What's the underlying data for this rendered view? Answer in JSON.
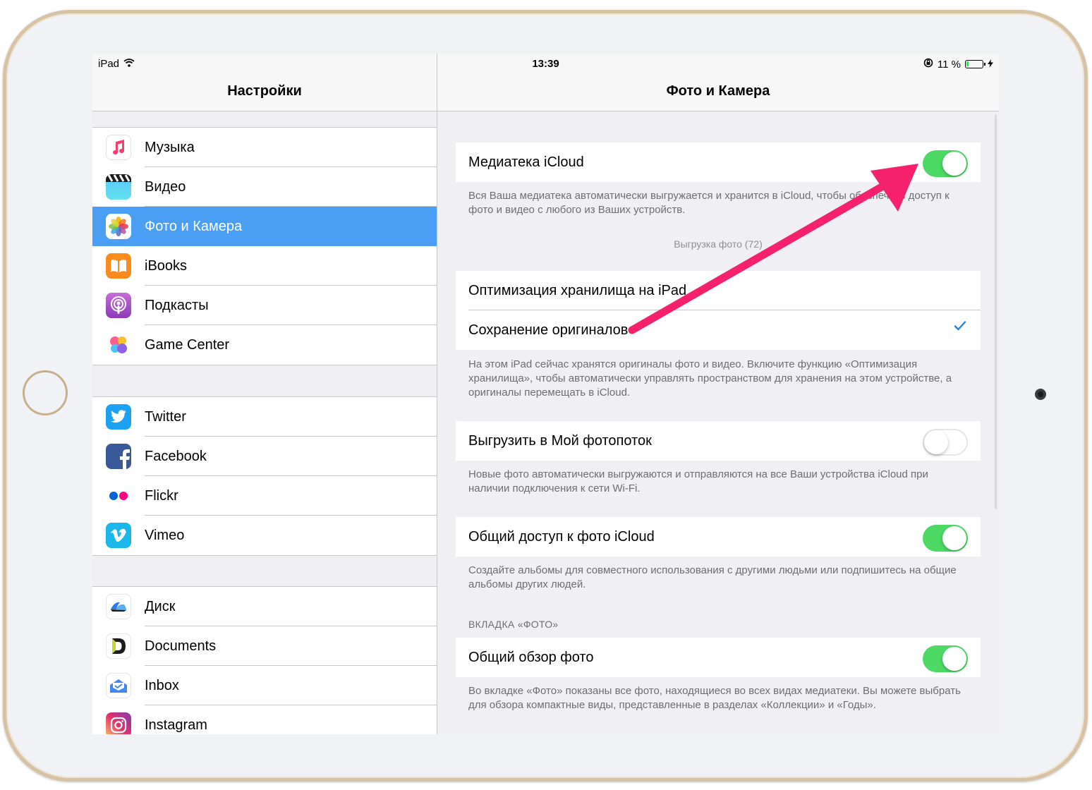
{
  "status_bar": {
    "device": "iPad",
    "time": "13:39",
    "battery_percent": "11 %",
    "battery_level": 0.11
  },
  "master": {
    "title": "Настройки",
    "groups": [
      {
        "items": [
          {
            "label": "Музыка",
            "icon": "music-icon"
          },
          {
            "label": "Видео",
            "icon": "video-icon"
          },
          {
            "label": "Фото и Камера",
            "icon": "photos-icon",
            "selected": true
          },
          {
            "label": "iBooks",
            "icon": "ibooks-icon"
          },
          {
            "label": "Подкасты",
            "icon": "podcasts-icon"
          },
          {
            "label": "Game Center",
            "icon": "game-center-icon"
          }
        ]
      },
      {
        "items": [
          {
            "label": "Twitter",
            "icon": "twitter-icon"
          },
          {
            "label": "Facebook",
            "icon": "facebook-icon"
          },
          {
            "label": "Flickr",
            "icon": "flickr-icon"
          },
          {
            "label": "Vimeo",
            "icon": "vimeo-icon"
          }
        ]
      },
      {
        "items": [
          {
            "label": "Диск",
            "icon": "disk-icon"
          },
          {
            "label": "Documents",
            "icon": "documents-icon"
          },
          {
            "label": "Inbox",
            "icon": "inbox-icon"
          },
          {
            "label": "Instagram",
            "icon": "instagram-icon"
          }
        ]
      }
    ]
  },
  "detail": {
    "title": "Фото и Камера",
    "icloud_library": {
      "label": "Медиатека iCloud",
      "on": true
    },
    "icloud_library_footer": "Вся Ваша медиатека автоматически выгружается и хранится в iCloud, чтобы обеспечить доступ к фото и видео с любого из Ваших устройств.",
    "upload_status": "Выгрузка фото (72)",
    "storage_options": [
      {
        "label": "Оптимизация хранилища на iPad",
        "checked": false
      },
      {
        "label": "Сохранение оригиналов",
        "checked": true
      }
    ],
    "storage_footer": "На этом iPad сейчас хранятся оригиналы фото и видео. Включите функцию «Оптимизация хранилища», чтобы автоматически управлять пространством для хранения на этом устройстве, а оригиналы перемещать в iCloud.",
    "photostream": {
      "label": "Выгрузить в Мой фотопоток",
      "on": false
    },
    "photostream_footer": "Новые фото автоматически выгружаются и отправляются на все Ваши устройства iCloud при наличии подключения к сети Wi-Fi.",
    "icloud_sharing": {
      "label": "Общий доступ к фото iCloud",
      "on": true
    },
    "icloud_sharing_footer": "Создайте альбомы для совместного использования с другими людьми или подпишитесь на общие альбомы других людей.",
    "photos_tab_header": "ВКЛАДКА «ФОТО»",
    "summarize_photos": {
      "label": "Общий обзор фото",
      "on": true
    },
    "summarize_footer": "Во вкладке «Фото» показаны все фото, находящиеся во всех видах медиатеки. Вы можете выбрать для обзора компактные виды, представленные в разделах «Коллекции» и «Годы»."
  },
  "colors": {
    "accent": "#4a9ff5",
    "toggle_on": "#4cd964",
    "arrow": "#f5216a",
    "check": "#1a82fb"
  }
}
